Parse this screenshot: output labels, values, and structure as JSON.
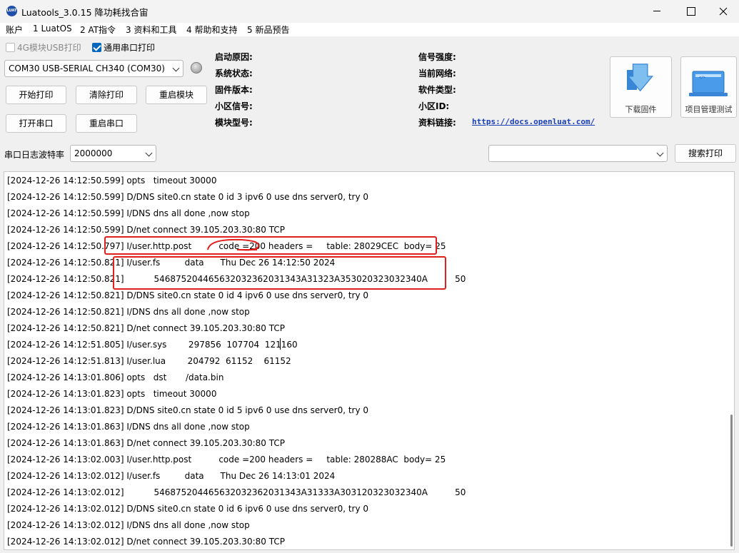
{
  "window": {
    "title": "Luatools_3.0.15 降功耗找合宙",
    "logo_text": "LUAT"
  },
  "menu": [
    "账户",
    "1 LuatOS",
    "2 AT指令",
    "3 资料和工具",
    "4 帮助和支持",
    "5 新品预告"
  ],
  "toolbar": {
    "cb_4g": "4G模块USB打印",
    "cb_serial": "通用串口打印",
    "port_selected": "COM30 USB-SERIAL CH340 (COM30)",
    "btn_start_print": "开始打印",
    "btn_clear_print": "清除打印",
    "btn_restart_module": "重启模块",
    "btn_open_port": "打开串口",
    "btn_restart_port": "重启串口",
    "baud_label": "串口日志波特率",
    "baud_value": "2000000",
    "search_value": "",
    "btn_search_print": "搜索打印",
    "btn_download_fw": "下载固件",
    "btn_project_test": "项目管理测试"
  },
  "info": {
    "boot_reason": "启动原因:",
    "sys_state": "系统状态:",
    "fw_version": "固件版本:",
    "cell_signal": "小区信号:",
    "module_model": "模块型号:",
    "signal_strength": "信号强度:",
    "current_network": "当前网络:",
    "software_type": "软件类型:",
    "cell_id": "小区ID:",
    "doc_link_label": "资料链接:",
    "doc_link": "https://docs.openluat.com/"
  },
  "colors": {
    "accent": "#0067c0",
    "annotation": "#e0201c",
    "link": "#1a3fb5"
  },
  "log": [
    "[2024-12-26 14:12:50.599] opts   timeout 30000",
    "[2024-12-26 14:12:50.599] D/DNS site0.cn state 0 id 3 ipv6 0 use dns server0, try 0",
    "[2024-12-26 14:12:50.599] I/DNS dns all done ,now stop",
    "[2024-12-26 14:12:50.599] D/net connect 39.105.203.30:80 TCP",
    "[2024-12-26 14:12:50.797] I/user.http.post          code =200 headers =     table: 28029CEC  body= 25",
    "[2024-12-26 14:12:50.821] I/user.fs         data      Thu Dec 26 14:12:50 2024",
    "[2024-12-26 14:12:50.821]           546875204465632032362031343A31323A353020323032340A          50",
    "[2024-12-26 14:12:50.821] D/DNS site0.cn state 0 id 4 ipv6 0 use dns server0, try 0",
    "[2024-12-26 14:12:50.821] I/DNS dns all done ,now stop",
    "[2024-12-26 14:12:50.821] D/net connect 39.105.203.30:80 TCP",
    "[2024-12-26 14:12:51.805] I/user.sys        297856  107704  121160",
    "[2024-12-26 14:12:51.813] I/user.lua        204792  61152    61152",
    "[2024-12-26 14:13:01.806] opts   dst       /data.bin",
    "[2024-12-26 14:13:01.823] opts   timeout 30000",
    "[2024-12-26 14:13:01.823] D/DNS site0.cn state 0 id 5 ipv6 0 use dns server0, try 0",
    "[2024-12-26 14:13:01.863] I/DNS dns all done ,now stop",
    "[2024-12-26 14:13:01.863] D/net connect 39.105.203.30:80 TCP",
    "[2024-12-26 14:13:02.003] I/user.http.post          code =200 headers =     table: 280288AC  body= 25",
    "[2024-12-26 14:13:02.012] I/user.fs         data      Thu Dec 26 14:13:01 2024",
    "[2024-12-26 14:13:02.012]           546875204465632032362031343A31333A303120323032340A          50",
    "[2024-12-26 14:13:02.012] D/DNS site0.cn state 0 id 6 ipv6 0 use dns server0, try 0",
    "[2024-12-26 14:13:02.012] I/DNS dns all done ,now stop",
    "[2024-12-26 14:13:02.012] D/net connect 39.105.203.30:80 TCP"
  ]
}
